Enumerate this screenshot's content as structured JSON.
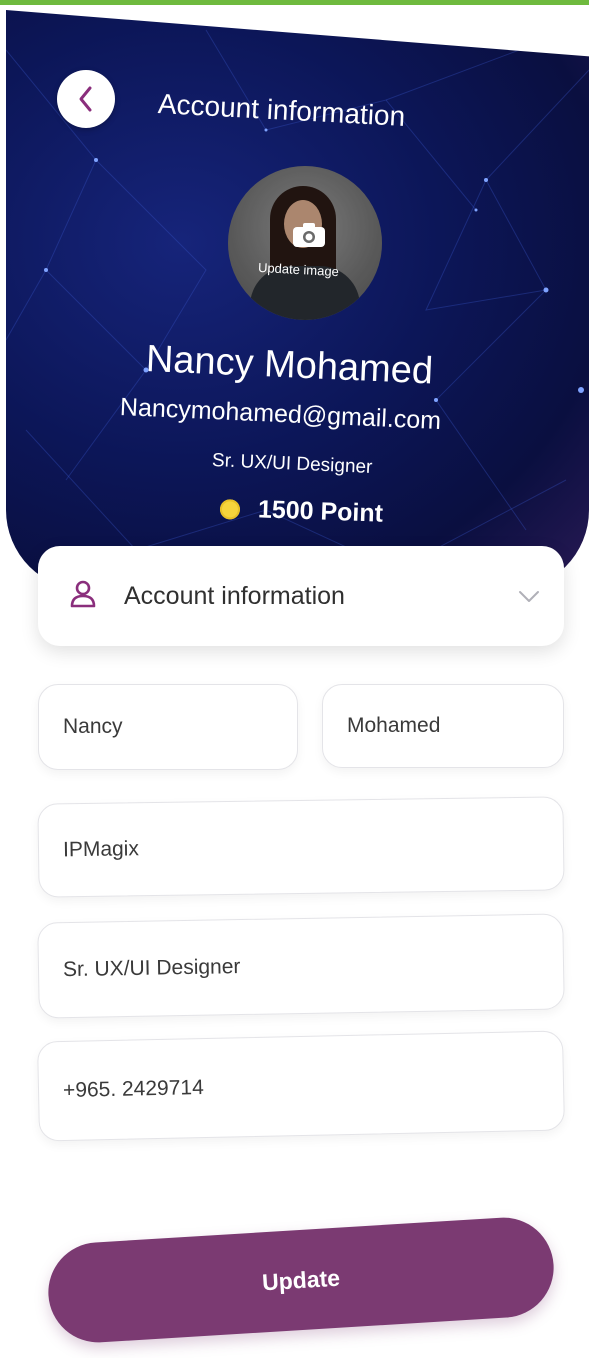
{
  "header": {
    "title": "Account information",
    "back_icon": "chevron-left-icon",
    "update_image_label": "Update image",
    "camera_icon": "camera-icon"
  },
  "profile": {
    "name": "Nancy Mohamed",
    "email": "Nancymohamed@gmail.com",
    "role": "Sr. UX/UI Designer",
    "points": "1500 Point"
  },
  "section": {
    "label": "Account information",
    "icon": "user-icon",
    "chevron": "chevron-down-icon"
  },
  "form": {
    "first_name": "Nancy",
    "last_name": "Mohamed",
    "company": "IPMagix",
    "job_title": "Sr. UX/UI Designer",
    "phone": "+965. 2429714"
  },
  "actions": {
    "update_label": "Update"
  },
  "colors": {
    "accent": "#7b3a72",
    "header_bg": "#0c1658",
    "coin": "#f6d43c",
    "top_bar": "#6fba3e"
  }
}
